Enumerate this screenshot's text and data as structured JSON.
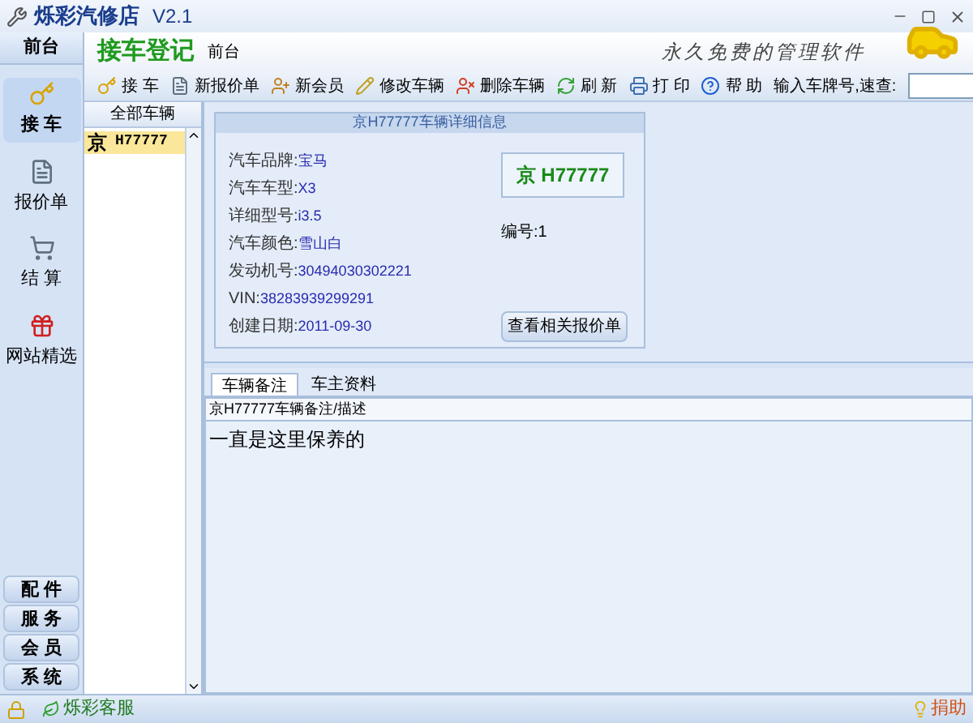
{
  "window": {
    "title": "烁彩汽修店",
    "version": "V2.1"
  },
  "header": {
    "title": "接车登记",
    "subtitle": "前台",
    "slogan": "永久免费的管理软件"
  },
  "sidebar": {
    "top_group": "前台",
    "items": [
      {
        "label": "接 车",
        "kind": "key",
        "selected": true
      },
      {
        "label": "报价单",
        "kind": "doc",
        "selected": false
      },
      {
        "label": "结 算",
        "kind": "cart",
        "selected": false
      },
      {
        "label": "网站精选",
        "kind": "gift",
        "selected": false
      }
    ],
    "groups": [
      "配 件",
      "服 务",
      "会 员",
      "系 统"
    ]
  },
  "toolbar": {
    "buttons": [
      {
        "label": "接 车",
        "kind": "key"
      },
      {
        "label": "新报价单",
        "kind": "doc"
      },
      {
        "label": "新会员",
        "kind": "user"
      },
      {
        "label": "修改车辆",
        "kind": "pencil"
      },
      {
        "label": "删除车辆",
        "kind": "delete"
      },
      {
        "label": "刷 新",
        "kind": "refresh"
      },
      {
        "label": "打 印",
        "kind": "print"
      },
      {
        "label": "帮 助",
        "kind": "help"
      }
    ],
    "search_label": "输入车牌号,速查:"
  },
  "vehicle_list": {
    "header": "全部车辆",
    "items": [
      {
        "province": "京",
        "plate": "H77777",
        "selected": true
      }
    ]
  },
  "details": {
    "title": "京H77777车辆详细信息",
    "plate": "京 H77777",
    "number": "编号:1",
    "fields": [
      {
        "label": "汽车品牌:",
        "value": "宝马"
      },
      {
        "label": "汽车车型:",
        "value": "X3"
      },
      {
        "label": "详细型号:",
        "value": "i3.5"
      },
      {
        "label": "汽车颜色:",
        "value": "雪山白"
      },
      {
        "label": "发动机号:",
        "value": "30494030302221"
      },
      {
        "label": "VIN: ",
        "value": "38283939299291"
      },
      {
        "label": "创建日期:",
        "value": "2011-09-30"
      }
    ],
    "button": "查看相关报价单"
  },
  "notes": {
    "tabs": [
      {
        "label": "车辆备注",
        "selected": true
      },
      {
        "label": "车主资料",
        "selected": false
      }
    ],
    "header": "京H77777车辆备注/描述",
    "text": "一直是这里保养的"
  },
  "status_bar": {
    "brand": "烁彩客服",
    "donate": "捐助"
  }
}
